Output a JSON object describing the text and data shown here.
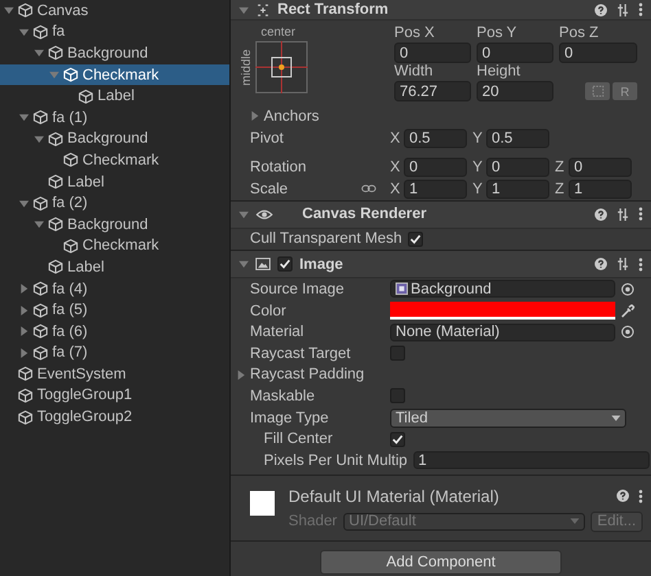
{
  "hierarchy": {
    "items": [
      {
        "name": "Canvas",
        "expanded": true,
        "selected": false,
        "children": [
          {
            "name": "fa",
            "expanded": true,
            "selected": false,
            "children": [
              {
                "name": "Background",
                "expanded": true,
                "selected": false,
                "children": [
                  {
                    "name": "Checkmark",
                    "expanded": true,
                    "selected": true,
                    "children": [
                      {
                        "name": "Label",
                        "selected": false
                      }
                    ]
                  }
                ]
              }
            ]
          },
          {
            "name": "fa (1)",
            "expanded": true,
            "selected": false,
            "children": [
              {
                "name": "Background",
                "expanded": true,
                "selected": false,
                "children": [
                  {
                    "name": "Checkmark",
                    "selected": false
                  }
                ]
              },
              {
                "name": "Label",
                "selected": false
              }
            ]
          },
          {
            "name": "fa (2)",
            "expanded": true,
            "selected": false,
            "children": [
              {
                "name": "Background",
                "expanded": true,
                "selected": false,
                "children": [
                  {
                    "name": "Checkmark",
                    "selected": false
                  }
                ]
              },
              {
                "name": "Label",
                "selected": false
              }
            ]
          },
          {
            "name": "fa (4)",
            "expanded": false,
            "selected": false
          },
          {
            "name": "fa (5)",
            "expanded": false,
            "selected": false
          },
          {
            "name": "fa (6)",
            "expanded": false,
            "selected": false
          },
          {
            "name": "fa (7)",
            "expanded": false,
            "selected": false
          }
        ]
      },
      {
        "name": "EventSystem",
        "selected": false
      },
      {
        "name": "ToggleGroup1",
        "selected": false
      },
      {
        "name": "ToggleGroup2",
        "selected": false
      }
    ]
  },
  "inspector": {
    "rect_transform": {
      "title": "Rect Transform",
      "expanded": true,
      "anchor_h": "center",
      "anchor_v": "middle",
      "top_fields": [
        {
          "label": "Pos X",
          "value": "0"
        },
        {
          "label": "Pos Y",
          "value": "0"
        },
        {
          "label": "Pos Z",
          "value": "0"
        },
        {
          "label": "Width",
          "value": "76.27"
        },
        {
          "label": "Height",
          "value": "20"
        }
      ],
      "reset_button": "R",
      "anchors": {
        "label": "Anchors",
        "expanded": false
      },
      "rows": [
        {
          "label": "Pivot",
          "kind": "plain",
          "axes": [
            {
              "axis": "X",
              "value": "0.5"
            },
            {
              "axis": "Y",
              "value": "0.5"
            }
          ]
        },
        {
          "label": "Rotation",
          "kind": "plain",
          "axes": [
            {
              "axis": "X",
              "value": "0"
            },
            {
              "axis": "Y",
              "value": "0"
            },
            {
              "axis": "Z",
              "value": "0"
            }
          ]
        },
        {
          "label": "Scale",
          "kind": "linked",
          "axes": [
            {
              "axis": "X",
              "value": "1"
            },
            {
              "axis": "Y",
              "value": "1"
            },
            {
              "axis": "Z",
              "value": "1"
            }
          ]
        }
      ]
    },
    "canvas_renderer": {
      "title": "Canvas Renderer",
      "expanded": true,
      "props": [
        {
          "label": "Cull Transparent Mesh",
          "kind": "checkbox",
          "checked": true
        }
      ]
    },
    "image": {
      "title": "Image",
      "expanded": true,
      "enabled": true,
      "props": [
        {
          "label": "Source Image",
          "kind": "object",
          "value": "Background",
          "has_thumb": true
        },
        {
          "label": "Color",
          "kind": "color",
          "color": "#ff0000"
        },
        {
          "label": "Material",
          "kind": "object",
          "value": "None (Material)"
        },
        {
          "label": "Raycast Target",
          "kind": "checkbox",
          "checked": false
        },
        {
          "label": "Raycast Padding",
          "kind": "foldout",
          "expanded": false
        },
        {
          "label": "Maskable",
          "kind": "checkbox",
          "checked": false
        },
        {
          "label": "Image Type",
          "kind": "dropdown",
          "value": "Tiled",
          "children": [
            {
              "label": "Fill Center",
              "kind": "checkbox",
              "checked": true
            },
            {
              "label": "Pixels Per Unit Multip",
              "kind": "text",
              "value": "1"
            }
          ]
        }
      ]
    },
    "material": {
      "name": "Default UI Material (Material)",
      "shader_label": "Shader",
      "shader": "UI/Default",
      "edit_button": "Edit..."
    },
    "add_component": "Add Component"
  }
}
